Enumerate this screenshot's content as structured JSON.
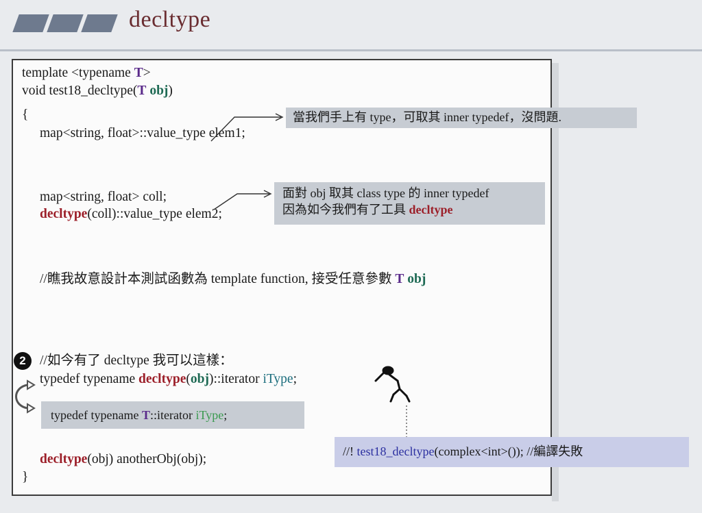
{
  "slide": {
    "title": "decltype"
  },
  "code": {
    "line1_a": "template <typename ",
    "line1_T": "T",
    "line1_b": ">",
    "line2_a": "void test18_decltype(",
    "line2_T": "T",
    "line2_obj": "obj",
    "line2_b": ")",
    "line3": "{",
    "line4": "map<string, float>::value_type elem1;",
    "line5": "map<string, float> coll;",
    "line6_kw": "decltype",
    "line6_rest": "(coll)::value_type elem2;",
    "line7_a": "//瞧我故意設計本測試函數為 template function, 接受任意參數 ",
    "line7_T": "T",
    "line7_obj": "obj",
    "line8": "//如今有了 decltype 我可以這樣：",
    "line9_a": "typedef typename ",
    "line9_kw": "decltype",
    "line9_b": "(",
    "line9_obj": "obj",
    "line9_c": ")::iterator ",
    "line9_iType": "iType",
    "line9_d": ";",
    "line10_a": "typedef typename ",
    "line10_T": "T",
    "line10_b": "::iterator ",
    "line10_iType": "iType",
    "line10_c": ";",
    "line11_kw": "decltype",
    "line11_rest": "(obj) anotherObj(obj);",
    "line12": "}"
  },
  "callouts": {
    "c1": "當我們手上有 type，可取其 inner typedef，沒問題.",
    "c2_line1": "面對 obj 取其 class type 的 inner typedef",
    "c2_line2_a": "因為如今我們有了工具 ",
    "c2_line2_kw": "decltype",
    "c3_a": "//! ",
    "c3_fn": "test18_decltype",
    "c3_b": "(complex<int>()); //編譯失敗"
  },
  "marker": {
    "number": "2"
  },
  "colors": {
    "title": "#6a2d31",
    "keyword_red": "#9c1f29",
    "keyword_purple": "#5a2a8a",
    "keyword_green": "#1e6a54",
    "callout_bg": "#c7ccd3"
  }
}
